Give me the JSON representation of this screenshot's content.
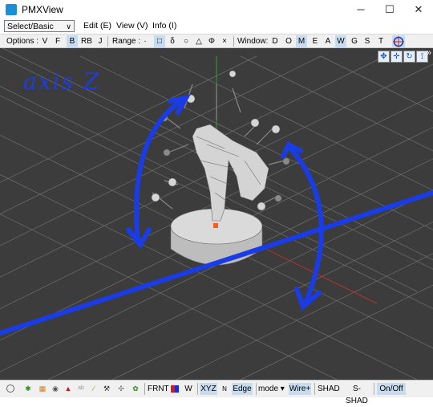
{
  "window": {
    "title": "PMXView",
    "minimize": "─",
    "maximize": "☐",
    "close": "✕"
  },
  "menubar": {
    "editor_select": "Select/Basic Editor",
    "items": [
      "Edit (E)",
      "View (V)",
      "Info (I)"
    ]
  },
  "options_bar": {
    "options_label": "Options :",
    "options": [
      "V",
      "F",
      "B",
      "RB",
      "J"
    ],
    "range_label": "Range :",
    "range": [
      "·",
      "□",
      "δ",
      "○",
      "△",
      "Φ",
      "×"
    ],
    "window_label": "Window:",
    "windows": [
      "D",
      "O",
      "M",
      "E",
      "A",
      "W",
      "G",
      "S",
      "T"
    ]
  },
  "viewport": {
    "annotation": "axis Z",
    "nav_more": "»"
  },
  "statusbar": {
    "frnt": "FRNT",
    "w": "W",
    "xyz": "XYZ",
    "edge": "Edge",
    "mode": "mode",
    "wire": "Wire+",
    "shad": "SHAD",
    "s_shad": "S-SHAD",
    "on_off": "On/Off"
  },
  "colors": {
    "viewport_bg": "#3c3c3c",
    "annotation_blue": "#1e3cdc",
    "active_button": "#c8dcf0"
  }
}
